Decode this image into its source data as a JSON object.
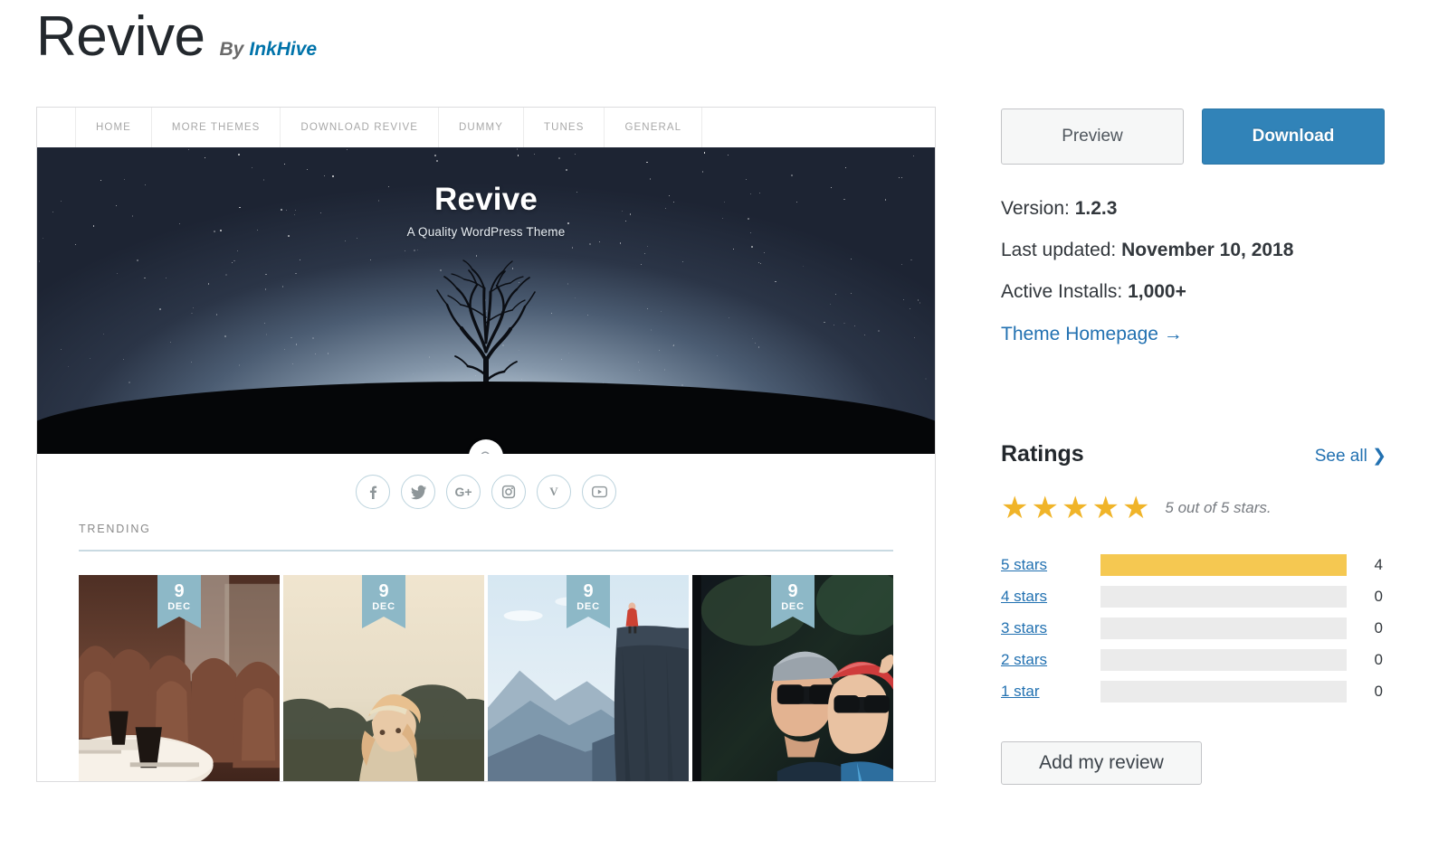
{
  "header": {
    "theme_name": "Revive",
    "by_label": "By",
    "author": "InkHive"
  },
  "preview": {
    "nav": [
      {
        "label": "HOME"
      },
      {
        "label": "MORE THEMES"
      },
      {
        "label": "DOWNLOAD REVIVE"
      },
      {
        "label": "DUMMY"
      },
      {
        "label": "TUNES"
      },
      {
        "label": "GENERAL"
      }
    ],
    "hero": {
      "title": "Revive",
      "subtitle": "A Quality WordPress Theme",
      "search_icon": "search-icon"
    },
    "social": [
      {
        "name": "facebook-icon",
        "glyph": "f"
      },
      {
        "name": "twitter-icon",
        "glyph": "✉"
      },
      {
        "name": "google-plus-icon",
        "glyph": "G+"
      },
      {
        "name": "instagram-icon",
        "glyph": "▣"
      },
      {
        "name": "vine-icon",
        "glyph": "V"
      },
      {
        "name": "youtube-icon",
        "glyph": "▶"
      }
    ],
    "trending_label": "TRENDING",
    "posts": [
      {
        "day": "9",
        "month": "DEC",
        "image": "cafe-chairs-photo"
      },
      {
        "day": "9",
        "month": "DEC",
        "image": "blonde-woman-field-photo"
      },
      {
        "day": "9",
        "month": "DEC",
        "image": "cliff-hiker-fjord-photo"
      },
      {
        "day": "9",
        "month": "DEC",
        "image": "couple-sunglasses-photo"
      }
    ]
  },
  "sidebar": {
    "preview_button": "Preview",
    "download_button": "Download",
    "version_label": "Version:",
    "version_value": "1.2.3",
    "updated_label": "Last updated:",
    "updated_value": "November 10, 2018",
    "installs_label": "Active Installs:",
    "installs_value": "1,000+",
    "homepage_link": "Theme Homepage  →",
    "ratings_title": "Ratings",
    "see_all": "See all  ❯",
    "stars_filled": 5,
    "stars_caption": "5 out of 5 stars.",
    "rating_bars": [
      {
        "label": "5 stars",
        "count": "4",
        "percent": 100
      },
      {
        "label": "4 stars",
        "count": "0",
        "percent": 0
      },
      {
        "label": "3 stars",
        "count": "0",
        "percent": 0
      },
      {
        "label": "2 stars",
        "count": "0",
        "percent": 0
      },
      {
        "label": "1 star",
        "count": "0",
        "percent": 0
      }
    ],
    "add_review_button": "Add my review"
  },
  "colors": {
    "download_blue": "#3183b8",
    "link_blue": "#2271b1",
    "star_gold": "#f0b429",
    "bar_gold": "#f5c851",
    "bar_track": "#ebebeb",
    "badge_blue": "#8db8c7"
  }
}
